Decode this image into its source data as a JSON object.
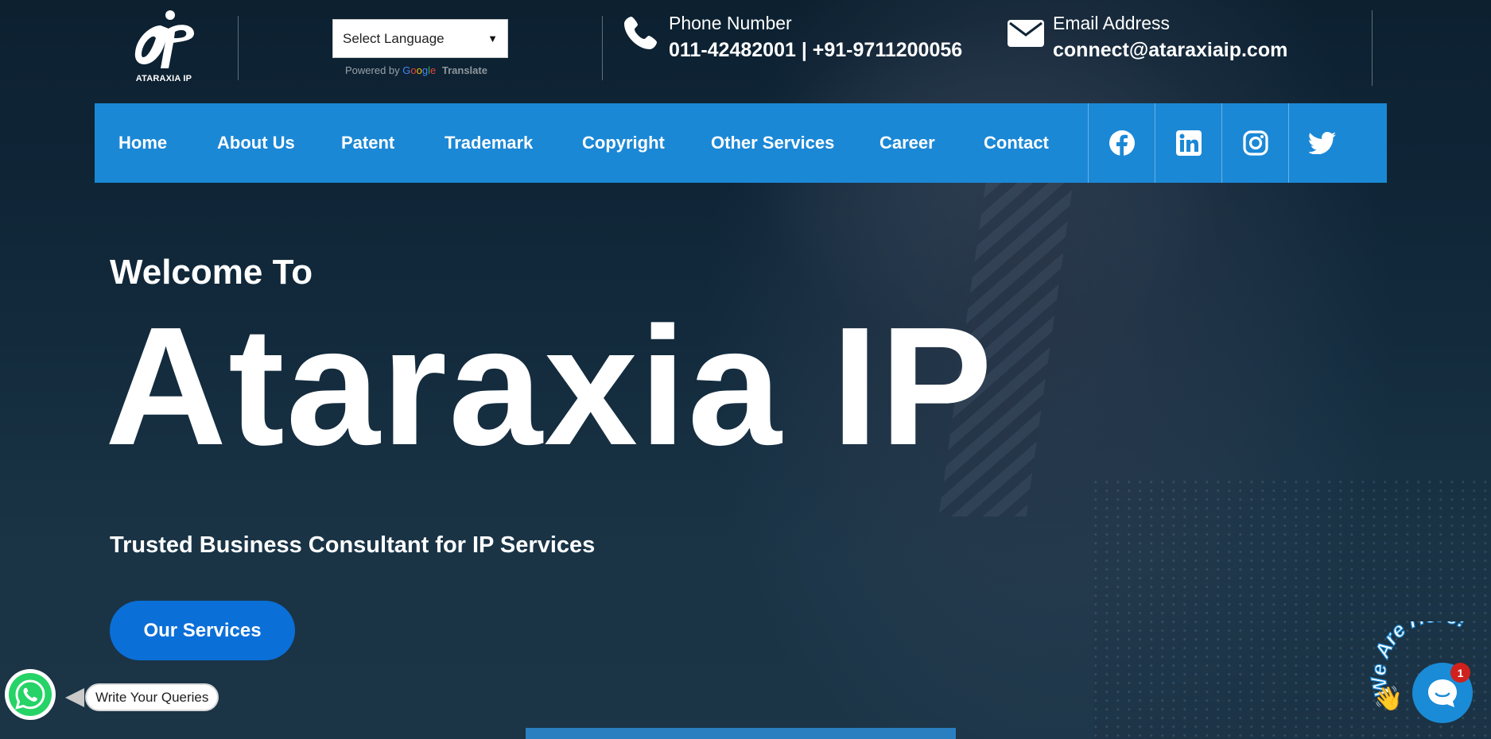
{
  "brand": {
    "logo_text": "ATARAXIA IP"
  },
  "language": {
    "selected": "Select Language",
    "powered_by": "Powered by",
    "google": [
      "G",
      "o",
      "o",
      "g",
      "l",
      "e"
    ],
    "translate": "Translate"
  },
  "contact": {
    "phone_label": "Phone Number",
    "phone_value": "011-42482001 | +91-9711200056",
    "email_label": "Email Address",
    "email_value": "connect@ataraxiaip.com"
  },
  "nav": {
    "items": [
      {
        "label": "Home"
      },
      {
        "label": "About Us"
      },
      {
        "label": "Patent"
      },
      {
        "label": "Trademark"
      },
      {
        "label": "Copyright"
      },
      {
        "label": "Other Services"
      },
      {
        "label": "Career"
      },
      {
        "label": "Contact"
      }
    ],
    "social": [
      "facebook-icon",
      "linkedin-icon",
      "instagram-icon",
      "twitter-icon"
    ]
  },
  "hero": {
    "welcome": "Welcome To",
    "title": "Ataraxia IP",
    "subtitle": "Trusted Business Consultant for IP Services",
    "cta": "Our Services"
  },
  "whatsapp": {
    "bubble": "Write Your Queries"
  },
  "chat": {
    "arc_text": "We Are Here!",
    "badge_count": "1"
  },
  "colors": {
    "nav_bg": "#1b88d6",
    "cta_bg": "#0b6fd8",
    "whatsapp_green": "#25d366",
    "chat_blue": "#1a8bd6",
    "badge_red": "#d0211c"
  }
}
